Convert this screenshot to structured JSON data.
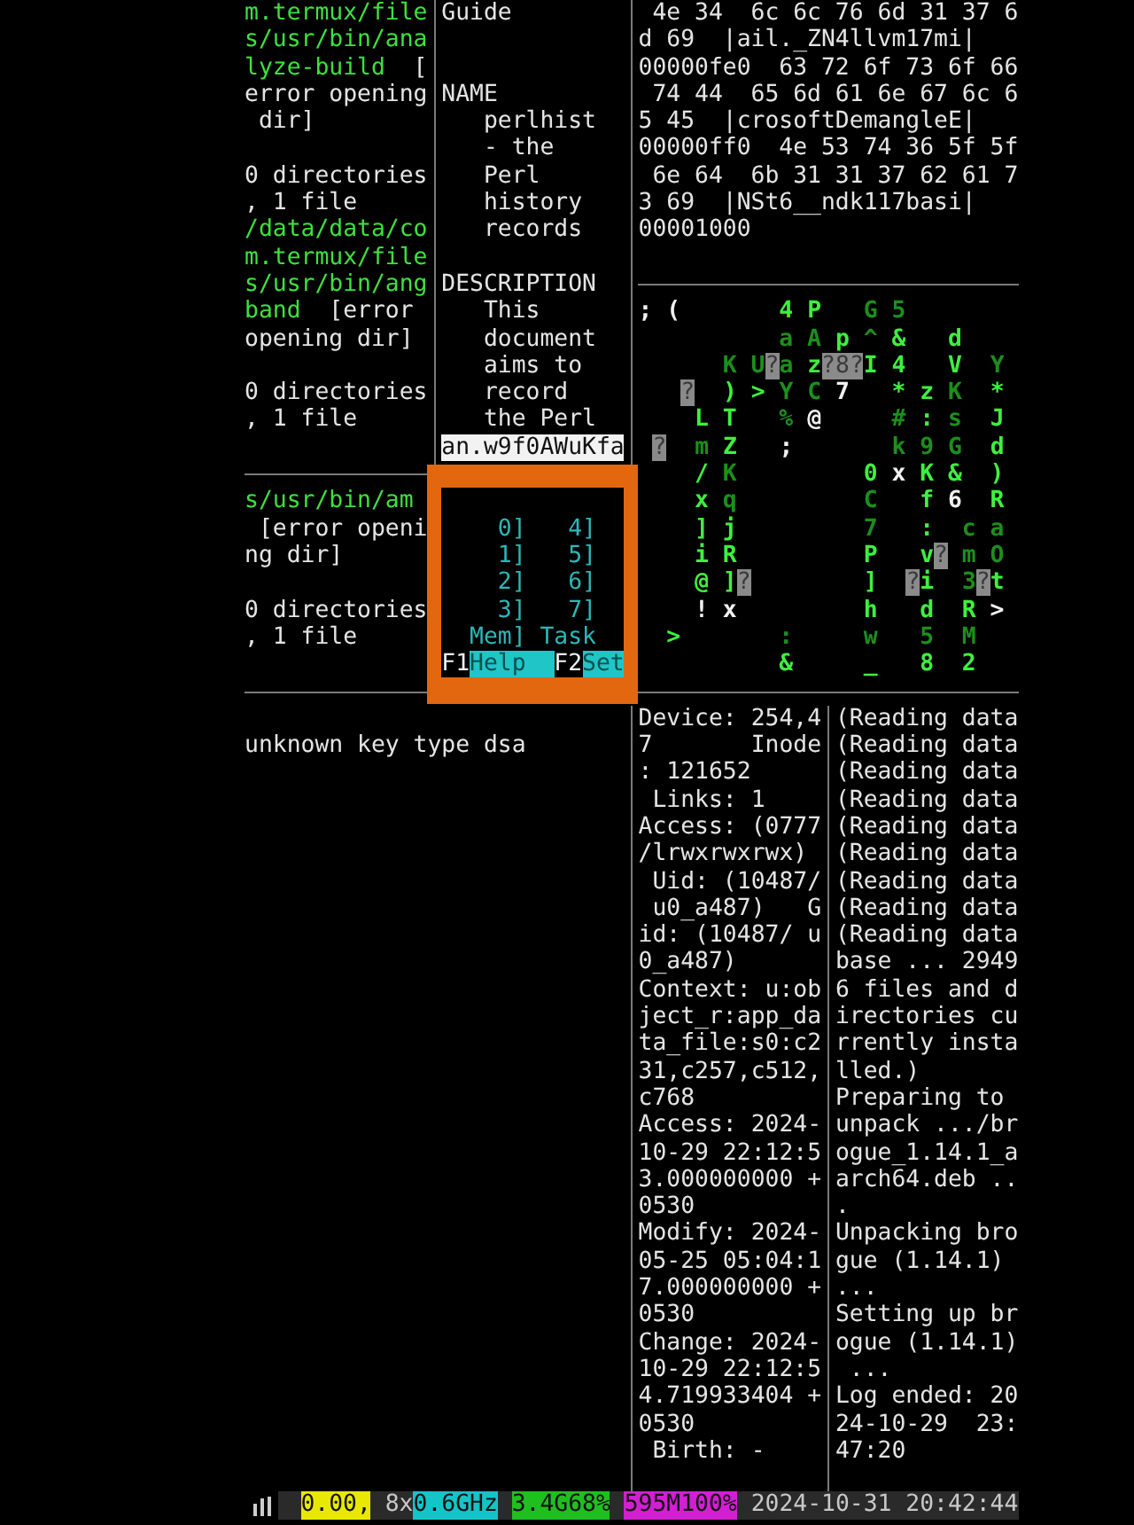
{
  "panes": {
    "tree_output_top": {
      "lines": [
        {
          "kind": "text",
          "path": "m.termux/file"
        },
        {
          "kind": "text",
          "path": "s/usr/bin/ana"
        },
        {
          "kind": "text",
          "path": "lyze-build",
          "text": "  ["
        },
        {
          "kind": "text",
          "text": "error opening"
        },
        {
          "kind": "text",
          "text": " dir]"
        },
        {
          "kind": "blank"
        },
        {
          "kind": "text",
          "text": "0 directories"
        },
        {
          "kind": "text",
          "text": ", 1 file"
        },
        {
          "kind": "text",
          "path": "/data/data/co"
        },
        {
          "kind": "text",
          "path": "m.termux/file"
        },
        {
          "kind": "text",
          "path": "s/usr/bin/ang"
        },
        {
          "kind": "text",
          "path": "band",
          "text": "  [error"
        },
        {
          "kind": "text",
          "text": "opening dir]"
        },
        {
          "kind": "blank"
        },
        {
          "kind": "text",
          "text": "0 directories"
        },
        {
          "kind": "text",
          "text": ", 1 file"
        }
      ]
    },
    "man_page": {
      "lines": [
        {
          "kind": "text",
          "text": "Guide"
        },
        {
          "kind": "blank"
        },
        {
          "kind": "blank"
        },
        {
          "kind": "text",
          "text": "NAME"
        },
        {
          "kind": "text",
          "text": "   perlhist"
        },
        {
          "kind": "text",
          "text": "   - the"
        },
        {
          "kind": "text",
          "text": "   Perl"
        },
        {
          "kind": "text",
          "text": "   history"
        },
        {
          "kind": "text",
          "text": "   records"
        },
        {
          "kind": "blank"
        },
        {
          "kind": "text",
          "text": "DESCRIPTION"
        },
        {
          "kind": "text",
          "text": "   This"
        },
        {
          "kind": "text",
          "text": "   document"
        },
        {
          "kind": "text",
          "text": "   aims to"
        },
        {
          "kind": "text",
          "text": "   record"
        },
        {
          "kind": "text",
          "text": "   the Perl"
        }
      ],
      "prompt": "an.w9f0AWuKfa"
    },
    "hexdump": {
      "lines": [
        {
          "kind": "text",
          "text": " 4e 34  6c 6c 76 6d 31 37 6"
        },
        {
          "kind": "text",
          "text": "d 69  |ail._ZN4llvm17mi|"
        },
        {
          "kind": "text",
          "text": "00000fe0  63 72 6f 73 6f 66"
        },
        {
          "kind": "text",
          "text": " 74 44  65 6d 61 6e 67 6c 6"
        },
        {
          "kind": "text",
          "text": "5 45  |crosoftDemangleE|"
        },
        {
          "kind": "text",
          "text": "00000ff0  4e 53 74 36 5f 5f"
        },
        {
          "kind": "text",
          "text": " 6e 64  6b 31 31 37 62 61 7"
        },
        {
          "kind": "text",
          "text": "3 69  |NSt6__ndk117basi|"
        },
        {
          "kind": "text",
          "text": "00001000"
        }
      ]
    },
    "tree_output_bottom": {
      "lines": [
        {
          "kind": "text",
          "path": "s/usr/bin/am"
        },
        {
          "kind": "text",
          "text": " [error openi"
        },
        {
          "kind": "text",
          "text": "ng dir]"
        },
        {
          "kind": "blank"
        },
        {
          "kind": "text",
          "text": "0 directories"
        },
        {
          "kind": "text",
          "text": ", 1 file"
        }
      ]
    },
    "matrix": {
      "rows": [
        {
          "runs": [
            {
              "kind": "glyph",
              "text": "; (",
              "color": "#f0f0f0"
            },
            {
              "kind": "glyph",
              "text": "       4 P",
              "color": "#3ef03e"
            },
            {
              "kind": "glyph",
              "text": "   G 5",
              "color": "#1c8f1c"
            }
          ]
        },
        {
          "runs": [
            {
              "kind": "glyph",
              "text": "          a A",
              "color": "#1c8f1c"
            },
            {
              "kind": "glyph",
              "text": " p",
              "color": "#3ef03e"
            },
            {
              "kind": "glyph",
              "text": " ^",
              "color": "#1c8f1c"
            },
            {
              "kind": "glyph",
              "text": " &   d",
              "color": "#3ef03e"
            }
          ]
        },
        {
          "runs": [
            {
              "kind": "glyph",
              "text": "      K U",
              "color": "#1c8f1c"
            },
            {
              "kind": "box",
              "text": "?"
            },
            {
              "kind": "glyph",
              "text": "a",
              "color": "#1c8f1c"
            },
            {
              "kind": "glyph",
              "text": " z",
              "color": "#3ef03e"
            },
            {
              "kind": "box",
              "text": "?8?"
            },
            {
              "kind": "glyph",
              "text": "I 4   V",
              "color": "#3ef03e"
            },
            {
              "kind": "glyph",
              "text": "  Y",
              "color": "#1c8f1c"
            }
          ]
        },
        {
          "runs": [
            {
              "kind": "box",
              "text": "   ?"
            },
            {
              "kind": "glyph",
              "text": "  ) >",
              "color": "#3ef03e"
            },
            {
              "kind": "glyph",
              "text": " Y C",
              "color": "#1c8f1c"
            },
            {
              "kind": "glyph",
              "text": " 7",
              "color": "#f0f0f0"
            },
            {
              "kind": "glyph",
              "text": "   * z",
              "color": "#3ef03e"
            },
            {
              "kind": "glyph",
              "text": " K",
              "color": "#1c8f1c"
            },
            {
              "kind": "glyph",
              "text": "  *",
              "color": "#3ef03e"
            }
          ]
        },
        {
          "runs": [
            {
              "kind": "glyph",
              "text": "    L T",
              "color": "#3ef03e"
            },
            {
              "kind": "glyph",
              "text": "   %",
              "color": "#1c8f1c"
            },
            {
              "kind": "glyph",
              "text": " @",
              "color": "#f0f0f0"
            },
            {
              "kind": "glyph",
              "text": "     #",
              "color": "#1c8f1c"
            },
            {
              "kind": "glyph",
              "text": " :",
              "color": "#3ef03e"
            },
            {
              "kind": "glyph",
              "text": " s",
              "color": "#1c8f1c"
            },
            {
              "kind": "glyph",
              "text": "  J",
              "color": "#3ef03e"
            }
          ]
        },
        {
          "runs": [
            {
              "kind": "box",
              "text": " ?"
            },
            {
              "kind": "glyph",
              "text": "  m",
              "color": "#1c8f1c"
            },
            {
              "kind": "glyph",
              "text": " Z",
              "color": "#3ef03e"
            },
            {
              "kind": "glyph",
              "text": "   ;",
              "color": "#f0f0f0"
            },
            {
              "kind": "glyph",
              "text": "       k 9 G",
              "color": "#1c8f1c"
            },
            {
              "kind": "glyph",
              "text": "  d",
              "color": "#3ef03e"
            }
          ]
        },
        {
          "runs": [
            {
              "kind": "glyph",
              "text": "    /",
              "color": "#3ef03e"
            },
            {
              "kind": "glyph",
              "text": " K",
              "color": "#1c8f1c"
            },
            {
              "kind": "glyph",
              "text": "         0",
              "color": "#3ef03e"
            },
            {
              "kind": "glyph",
              "text": " x",
              "color": "#f0f0f0"
            },
            {
              "kind": "glyph",
              "text": " K &  )",
              "color": "#3ef03e"
            }
          ]
        },
        {
          "runs": [
            {
              "kind": "glyph",
              "text": "    x",
              "color": "#3ef03e"
            },
            {
              "kind": "glyph",
              "text": " q         C",
              "color": "#1c8f1c"
            },
            {
              "kind": "glyph",
              "text": "   f",
              "color": "#3ef03e"
            },
            {
              "kind": "glyph",
              "text": " 6",
              "color": "#f0f0f0"
            },
            {
              "kind": "glyph",
              "text": "  R",
              "color": "#3ef03e"
            }
          ]
        },
        {
          "runs": [
            {
              "kind": "glyph",
              "text": "    ] j",
              "color": "#3ef03e"
            },
            {
              "kind": "glyph",
              "text": "         7",
              "color": "#1c8f1c"
            },
            {
              "kind": "glyph",
              "text": "   :",
              "color": "#3ef03e"
            },
            {
              "kind": "glyph",
              "text": "  c a",
              "color": "#1c8f1c"
            }
          ]
        },
        {
          "runs": [
            {
              "kind": "glyph",
              "text": "    i R         P   v",
              "color": "#3ef03e"
            },
            {
              "kind": "box",
              "text": "?"
            },
            {
              "kind": "glyph",
              "text": " m O",
              "color": "#1c8f1c"
            }
          ]
        },
        {
          "runs": [
            {
              "kind": "glyph",
              "text": "    @ ]",
              "color": "#3ef03e"
            },
            {
              "kind": "box",
              "text": "?"
            },
            {
              "kind": "glyph",
              "text": "        ]",
              "color": "#3ef03e"
            },
            {
              "kind": "box",
              "text": "  ?"
            },
            {
              "kind": "glyph",
              "text": "i",
              "color": "#3ef03e"
            },
            {
              "kind": "glyph",
              "text": "  3",
              "color": "#1c8f1c"
            },
            {
              "kind": "box",
              "text": "?"
            },
            {
              "kind": "glyph",
              "text": "t",
              "color": "#3ef03e"
            }
          ]
        },
        {
          "runs": [
            {
              "kind": "glyph",
              "text": "    ! x",
              "color": "#f0f0f0"
            },
            {
              "kind": "glyph",
              "text": "         h   d  R",
              "color": "#3ef03e"
            },
            {
              "kind": "glyph",
              "text": " >",
              "color": "#f0f0f0"
            }
          ]
        },
        {
          "runs": [
            {
              "kind": "glyph",
              "text": "  >",
              "color": "#3ef03e"
            },
            {
              "kind": "glyph",
              "text": "       :     w   5  M",
              "color": "#1c8f1c"
            }
          ]
        },
        {
          "runs": [
            {
              "kind": "glyph",
              "text": "          &     _   8  2",
              "color": "#3ef03e"
            }
          ]
        }
      ]
    },
    "ssh_output": {
      "lines": [
        {
          "kind": "blank"
        },
        {
          "kind": "text",
          "text": "unknown key type dsa"
        }
      ]
    },
    "stat_output": {
      "lines": [
        {
          "kind": "text",
          "text": "Device: 254,4"
        },
        {
          "kind": "text",
          "text": "7       Inode"
        },
        {
          "kind": "text",
          "text": ": 121652"
        },
        {
          "kind": "text",
          "text": " Links: 1"
        },
        {
          "kind": "text",
          "text": "Access: (0777"
        },
        {
          "kind": "text",
          "text": "/lrwxrwxrwx)"
        },
        {
          "kind": "text",
          "text": " Uid: (10487/"
        },
        {
          "kind": "text",
          "text": " u0_a487)   G"
        },
        {
          "kind": "text",
          "text": "id: (10487/ u"
        },
        {
          "kind": "text",
          "text": "0_a487)"
        },
        {
          "kind": "text",
          "text": "Context: u:ob"
        },
        {
          "kind": "text",
          "text": "ject_r:app_da"
        },
        {
          "kind": "text",
          "text": "ta_file:s0:c2"
        },
        {
          "kind": "text",
          "text": "31,c257,c512,"
        },
        {
          "kind": "text",
          "text": "c768"
        },
        {
          "kind": "text",
          "text": "Access: 2024-"
        },
        {
          "kind": "text",
          "text": "10-29 22:12:5"
        },
        {
          "kind": "text",
          "text": "3.000000000 +"
        },
        {
          "kind": "text",
          "text": "0530"
        },
        {
          "kind": "text",
          "text": "Modify: 2024-"
        },
        {
          "kind": "text",
          "text": "05-25 05:04:1"
        },
        {
          "kind": "text",
          "text": "7.000000000 +"
        },
        {
          "kind": "text",
          "text": "0530"
        },
        {
          "kind": "text",
          "text": "Change: 2024-"
        },
        {
          "kind": "text",
          "text": "10-29 22:12:5"
        },
        {
          "kind": "text",
          "text": "4.719933404 +"
        },
        {
          "kind": "text",
          "text": "0530"
        },
        {
          "kind": "text",
          "text": " Birth: -"
        }
      ]
    },
    "dpkg_log": {
      "lines": [
        {
          "kind": "text",
          "text": "(Reading data"
        },
        {
          "kind": "text",
          "text": "(Reading data"
        },
        {
          "kind": "text",
          "text": "(Reading data"
        },
        {
          "kind": "text",
          "text": "(Reading data"
        },
        {
          "kind": "text",
          "text": "(Reading data"
        },
        {
          "kind": "text",
          "text": "(Reading data"
        },
        {
          "kind": "text",
          "text": "(Reading data"
        },
        {
          "kind": "text",
          "text": "(Reading data"
        },
        {
          "kind": "text",
          "text": "(Reading data"
        },
        {
          "kind": "text",
          "text": "base ... 2949"
        },
        {
          "kind": "text",
          "text": "6 files and d"
        },
        {
          "kind": "text",
          "text": "irectories cu"
        },
        {
          "kind": "text",
          "text": "rrently insta"
        },
        {
          "kind": "text",
          "text": "lled.)"
        },
        {
          "kind": "text",
          "text": "Preparing to"
        },
        {
          "kind": "text",
          "text": "unpack .../br"
        },
        {
          "kind": "text",
          "text": "ogue_1.14.1_a"
        },
        {
          "kind": "text",
          "text": "arch64.deb .."
        },
        {
          "kind": "text",
          "text": "."
        },
        {
          "kind": "text",
          "text": "Unpacking bro"
        },
        {
          "kind": "text",
          "text": "gue (1.14.1)"
        },
        {
          "kind": "text",
          "text": "..."
        },
        {
          "kind": "text",
          "text": "Setting up br"
        },
        {
          "kind": "text",
          "text": "ogue (1.14.1)"
        },
        {
          "kind": "text",
          "text": " ..."
        },
        {
          "kind": "text",
          "text": "Log ended: 20"
        },
        {
          "kind": "text",
          "text": "24-10-29  23:"
        },
        {
          "kind": "text",
          "text": "47:20"
        }
      ]
    }
  },
  "meter_popup": {
    "cpu_meters": [
      {
        "left": "0]",
        "right": "4]"
      },
      {
        "left": "1]",
        "right": "5]"
      },
      {
        "left": "2]",
        "right": "6]"
      },
      {
        "left": "3]",
        "right": "7]"
      }
    ],
    "mem_label": "Mem]",
    "task_label": "Task",
    "keys": [
      {
        "key": "F1",
        "label": "Help"
      },
      {
        "key": "F2",
        "label": "Set"
      }
    ]
  },
  "status_bar": {
    "segments": [
      {
        "text": "0.00,",
        "color": "#e8e800"
      },
      {
        "text": "8x"
      },
      {
        "text": "0.6GHz",
        "color": "#14c4c8"
      },
      {
        "text": "3.4G68%",
        "color": "#1fbf1f"
      },
      {
        "text": "595M100%",
        "color": "#d21fd2"
      },
      {
        "text": "2024-10-31 20:42:44"
      }
    ]
  }
}
